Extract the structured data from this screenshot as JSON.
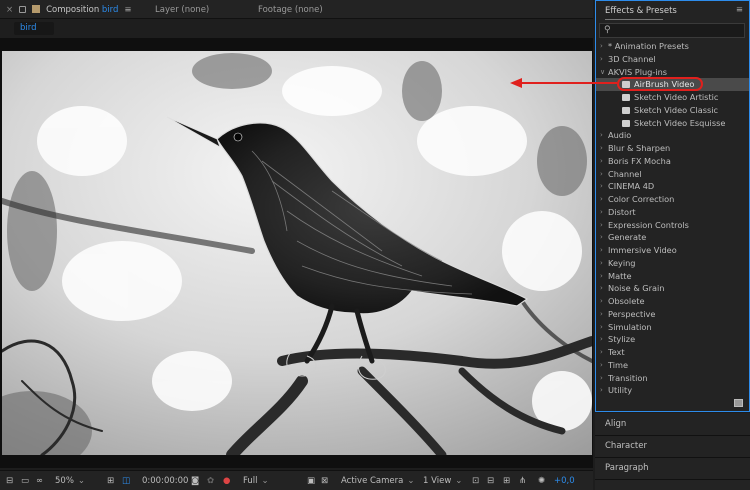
{
  "tabs": {
    "composition_label": "Composition",
    "composition_name": "bird",
    "layer": "Layer (none)",
    "footage": "Footage (none)"
  },
  "breadcrumb": "bird",
  "toolbar": {
    "zoom": "50%",
    "timecode": "0:00:00:00",
    "resolution": "Full",
    "camera": "Active Camera",
    "view": "1 View",
    "exposure": "+0,0"
  },
  "effects_panel": {
    "title": "Effects & Presets",
    "items": [
      {
        "label": "* Animation Presets",
        "type": "category"
      },
      {
        "label": "3D Channel",
        "type": "category"
      },
      {
        "label": "AKVIS Plug-ins",
        "type": "category",
        "expanded": true
      },
      {
        "label": "AirBrush Video",
        "type": "effect",
        "selected": true
      },
      {
        "label": "Sketch Video Artistic",
        "type": "effect"
      },
      {
        "label": "Sketch Video Classic",
        "type": "effect"
      },
      {
        "label": "Sketch Video Esquisse",
        "type": "effect"
      },
      {
        "label": "Audio",
        "type": "category"
      },
      {
        "label": "Blur & Sharpen",
        "type": "category"
      },
      {
        "label": "Boris FX Mocha",
        "type": "category"
      },
      {
        "label": "Channel",
        "type": "category"
      },
      {
        "label": "CINEMA 4D",
        "type": "category"
      },
      {
        "label": "Color Correction",
        "type": "category"
      },
      {
        "label": "Distort",
        "type": "category"
      },
      {
        "label": "Expression Controls",
        "type": "category"
      },
      {
        "label": "Generate",
        "type": "category"
      },
      {
        "label": "Immersive Video",
        "type": "category"
      },
      {
        "label": "Keying",
        "type": "category"
      },
      {
        "label": "Matte",
        "type": "category"
      },
      {
        "label": "Noise & Grain",
        "type": "category"
      },
      {
        "label": "Obsolete",
        "type": "category"
      },
      {
        "label": "Perspective",
        "type": "category"
      },
      {
        "label": "Simulation",
        "type": "category"
      },
      {
        "label": "Stylize",
        "type": "category"
      },
      {
        "label": "Text",
        "type": "category"
      },
      {
        "label": "Time",
        "type": "category"
      },
      {
        "label": "Transition",
        "type": "category"
      },
      {
        "label": "Utility",
        "type": "category"
      }
    ]
  },
  "side_panels": [
    "Align",
    "Character",
    "Paragraph"
  ],
  "colors": {
    "accent": "#2d8ceb",
    "callout": "#e0201d",
    "panel": "#232323"
  }
}
